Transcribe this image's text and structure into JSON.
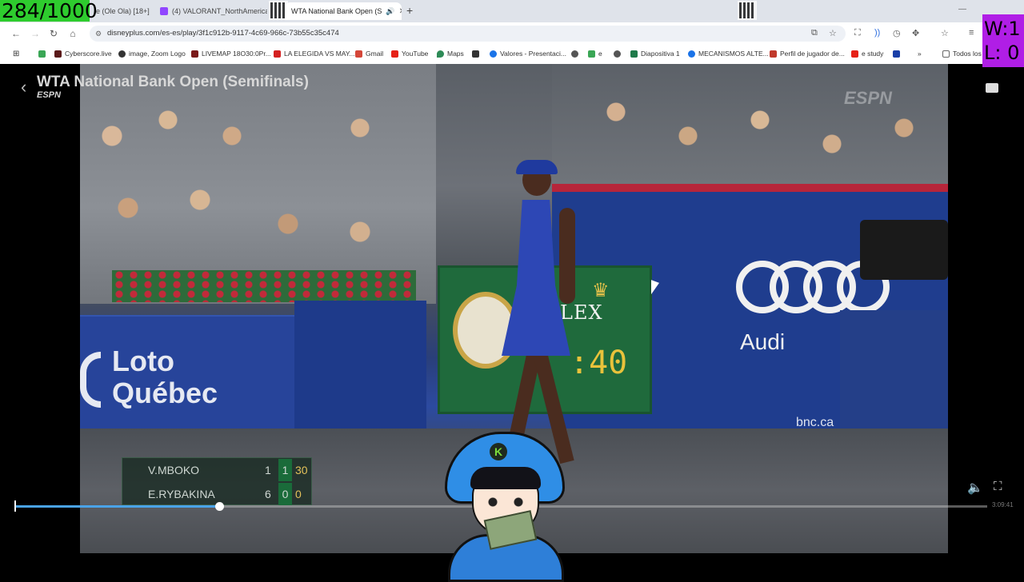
{
  "overlay": {
    "counter": "284/1000",
    "wins": "W:1",
    "losses": "L: 0"
  },
  "tabs": [
    {
      "label": "e (Ole Ola) [18+]",
      "active": false
    },
    {
      "label": "(4) VALORANT_NorthAmerica -",
      "active": false
    },
    {
      "label": "WTA National Bank Open (S",
      "active": true
    }
  ],
  "address": {
    "url": "disneyplus.com/es-es/play/3f1c912b-9117-4c69-966c-73b55c35c474"
  },
  "bookmarks": [
    {
      "label": "Cyberscore.live",
      "color": "#5a1a1a"
    },
    {
      "label": "image, Zoom Logo",
      "color": "#333333"
    },
    {
      "label": "LIVEMAP 18O30:0Pr...",
      "color": "#7a1a1a"
    },
    {
      "label": "LA ELEGIDA VS MAY...",
      "color": "#d42020"
    },
    {
      "label": "Gmail",
      "color": "#d44638"
    },
    {
      "label": "YouTube",
      "color": "#e62117"
    },
    {
      "label": "Maps",
      "color": "#2e8b57"
    },
    {
      "label": "",
      "color": "#333333"
    },
    {
      "label": "Valores - Presentaci...",
      "color": "#1a73e8"
    },
    {
      "label": "e",
      "color": "#3aa655"
    },
    {
      "label": "",
      "color": "#555555"
    },
    {
      "label": "Diapositiva 1",
      "color": "#1f7a4a"
    },
    {
      "label": "MECANISMOS ALTE...",
      "color": "#1a73e8"
    },
    {
      "label": "Perfil de jugador de...",
      "color": "#c0392b"
    },
    {
      "label": "e study",
      "color": "#e62117"
    },
    {
      "label": "",
      "color": "#1a3fa8"
    },
    {
      "label": "Todos los",
      "color": "#666666"
    }
  ],
  "player": {
    "title": "WTA National Bank Open (Semifinals)",
    "network": "ESPN",
    "network_watermark": "ESPN",
    "progress_fraction": 0.209,
    "time_remaining": "3:09:41"
  },
  "scene": {
    "rolex_brand": "LEX",
    "rolex_time": ":40",
    "audi_text": "Audi",
    "bnc_text": "bnc.ca",
    "loto_line1": "Loto",
    "loto_line2": "Québec"
  },
  "scoreboard": {
    "rows": [
      {
        "name": "V.MBOKO",
        "sets": "1",
        "games": "1",
        "points": "30"
      },
      {
        "name": "E.RYBAKINA",
        "sets": "6",
        "games": "0",
        "points": "0"
      }
    ]
  },
  "avatar_badge": "K",
  "colors": {
    "progress": "#4aa3e8",
    "counter_bg": "#2ecc2e",
    "wl_bg": "#b01ee6"
  }
}
